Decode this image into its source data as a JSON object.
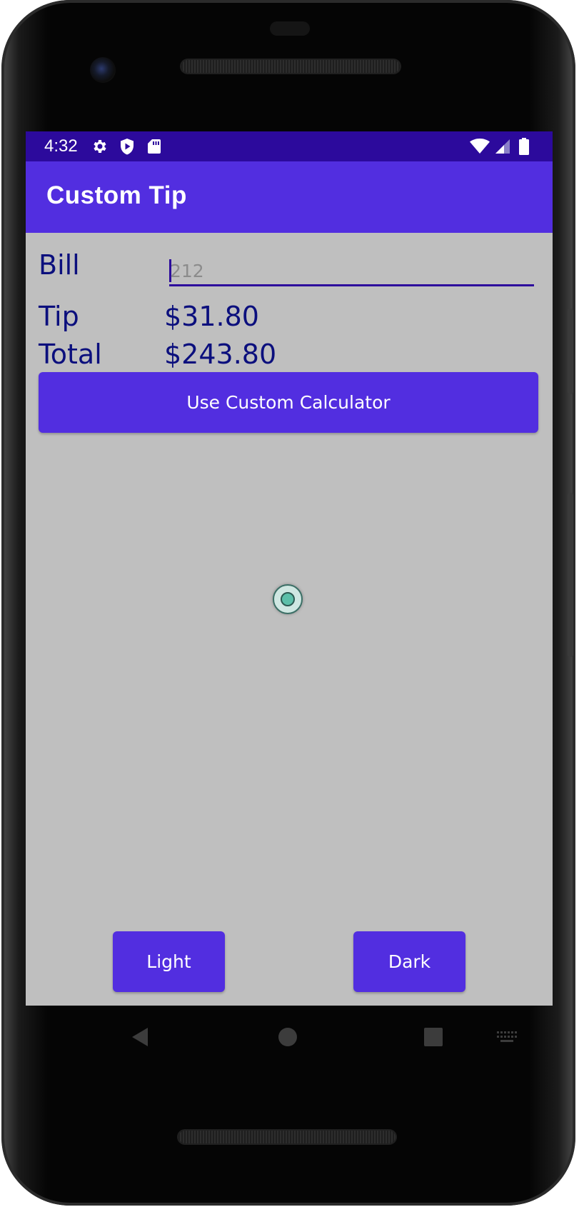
{
  "status_bar": {
    "time": "4:32",
    "icons": [
      "settings-gear-icon",
      "shield-play-icon",
      "sd-card-icon",
      "wifi-icon",
      "cellular-signal-icon",
      "battery-icon"
    ]
  },
  "app_bar": {
    "title": "Custom Tip"
  },
  "form": {
    "bill_label": "Bill",
    "bill_input_value": "",
    "bill_input_placeholder": "212",
    "tip_label": "Tip",
    "tip_value": "$31.80",
    "total_label": "Total",
    "total_value": "$243.80"
  },
  "buttons": {
    "custom_calculator": "Use Custom Calculator",
    "light": "Light",
    "dark": "Dark"
  },
  "nav_bar": {
    "icons": [
      "back-icon",
      "home-icon",
      "recents-icon",
      "keyboard-icon"
    ]
  },
  "colors": {
    "status_bar": "#2c0a9c",
    "app_bar": "#522ee0",
    "button": "#522ee0",
    "screen_background": "#bfbfbf",
    "label_text": "#0b0f7d"
  }
}
